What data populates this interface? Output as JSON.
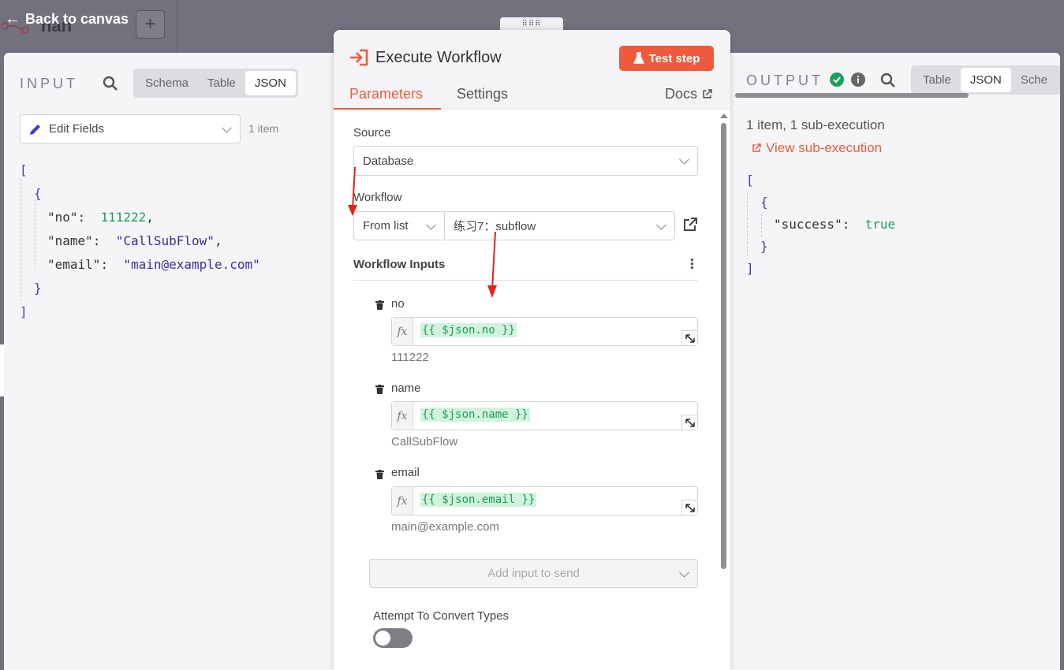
{
  "topbar": {
    "back_label": "Back to canvas",
    "workflow_name": "nan",
    "add_label": "+"
  },
  "input_panel": {
    "title": "INPUT",
    "views": [
      "Schema",
      "Table",
      "JSON"
    ],
    "active_view": "JSON",
    "node_select": "Edit Fields",
    "item_count": "1 item",
    "json": {
      "open_bracket": "[",
      "open_brace": "{",
      "fields": [
        {
          "key": "\"no\"",
          "value": "111222",
          "type": "number",
          "trail": ","
        },
        {
          "key": "\"name\"",
          "value": "\"CallSubFlow\"",
          "type": "string",
          "trail": ","
        },
        {
          "key": "\"email\"",
          "value": "\"main@example.com\"",
          "type": "string",
          "trail": ""
        }
      ],
      "close_brace": "}",
      "close_bracket": "]"
    }
  },
  "modal": {
    "title": "Execute Workflow",
    "test_button": "Test step",
    "tabs": [
      "Parameters",
      "Settings"
    ],
    "active_tab": "Parameters",
    "docs_label": "Docs",
    "source_label": "Source",
    "source_value": "Database",
    "workflow_label": "Workflow",
    "workflow_mode": "From list",
    "workflow_value": "练习7：subflow",
    "inputs_header": "Workflow Inputs",
    "inputs": [
      {
        "name": "no",
        "expression": "{{ $json.no }}",
        "preview": "111222"
      },
      {
        "name": "name",
        "expression": "{{ $json.name }}",
        "preview": "CallSubFlow"
      },
      {
        "name": "email",
        "expression": "{{ $json.email }}",
        "preview": "main@example.com"
      }
    ],
    "fx_label": "fx",
    "add_input_placeholder": "Add input to send",
    "convert_label": "Attempt To Convert Types",
    "convert_on": false
  },
  "output_panel": {
    "title": "OUTPUT",
    "views": [
      "Table",
      "JSON",
      "Sche"
    ],
    "active_view": "JSON",
    "summary": "1 item, 1 sub-execution",
    "sub_link": "View sub-execution",
    "json": {
      "open_bracket": "[",
      "open_brace": "{",
      "key": "\"success\"",
      "value": "true",
      "close_brace": "}",
      "close_bracket": "]"
    }
  },
  "colors": {
    "accent": "#ef5a3d",
    "success": "#19a05b",
    "canvas": "#74717f"
  }
}
